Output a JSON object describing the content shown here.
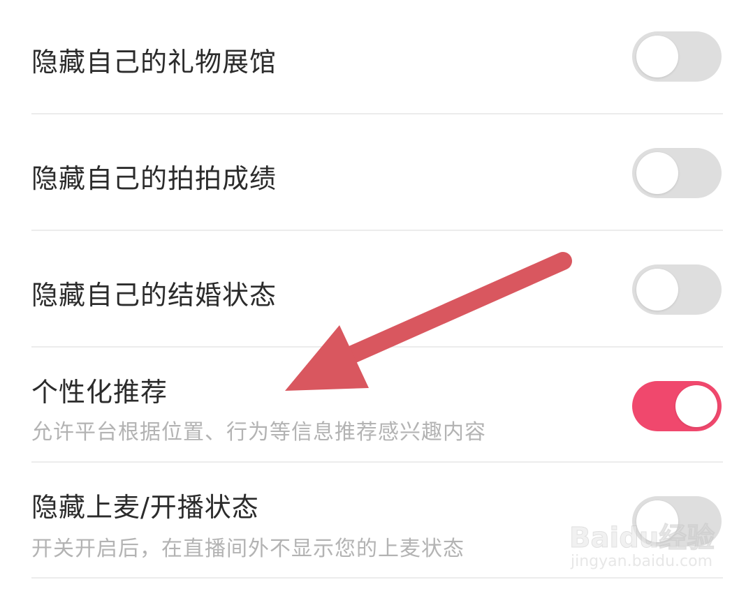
{
  "settings": [
    {
      "title": "隐藏自己的礼物展馆",
      "subtitle": "",
      "enabled": false
    },
    {
      "title": "隐藏自己的拍拍成绩",
      "subtitle": "",
      "enabled": false
    },
    {
      "title": "隐藏自己的结婚状态",
      "subtitle": "",
      "enabled": false
    },
    {
      "title": "个性化推荐",
      "subtitle": "允许平台根据位置、行为等信息推荐感兴趣内容",
      "enabled": true
    },
    {
      "title": "隐藏上麦/开播状态",
      "subtitle": "开关开启后，在直播间外不显示您的上麦状态",
      "enabled": false
    }
  ],
  "colors": {
    "toggle_on": "#f0486d",
    "toggle_off": "#dedede",
    "annotation_arrow": "#d9575f"
  },
  "watermark": {
    "brand": "Baidu经验",
    "url": "jingyan.baidu.com"
  }
}
